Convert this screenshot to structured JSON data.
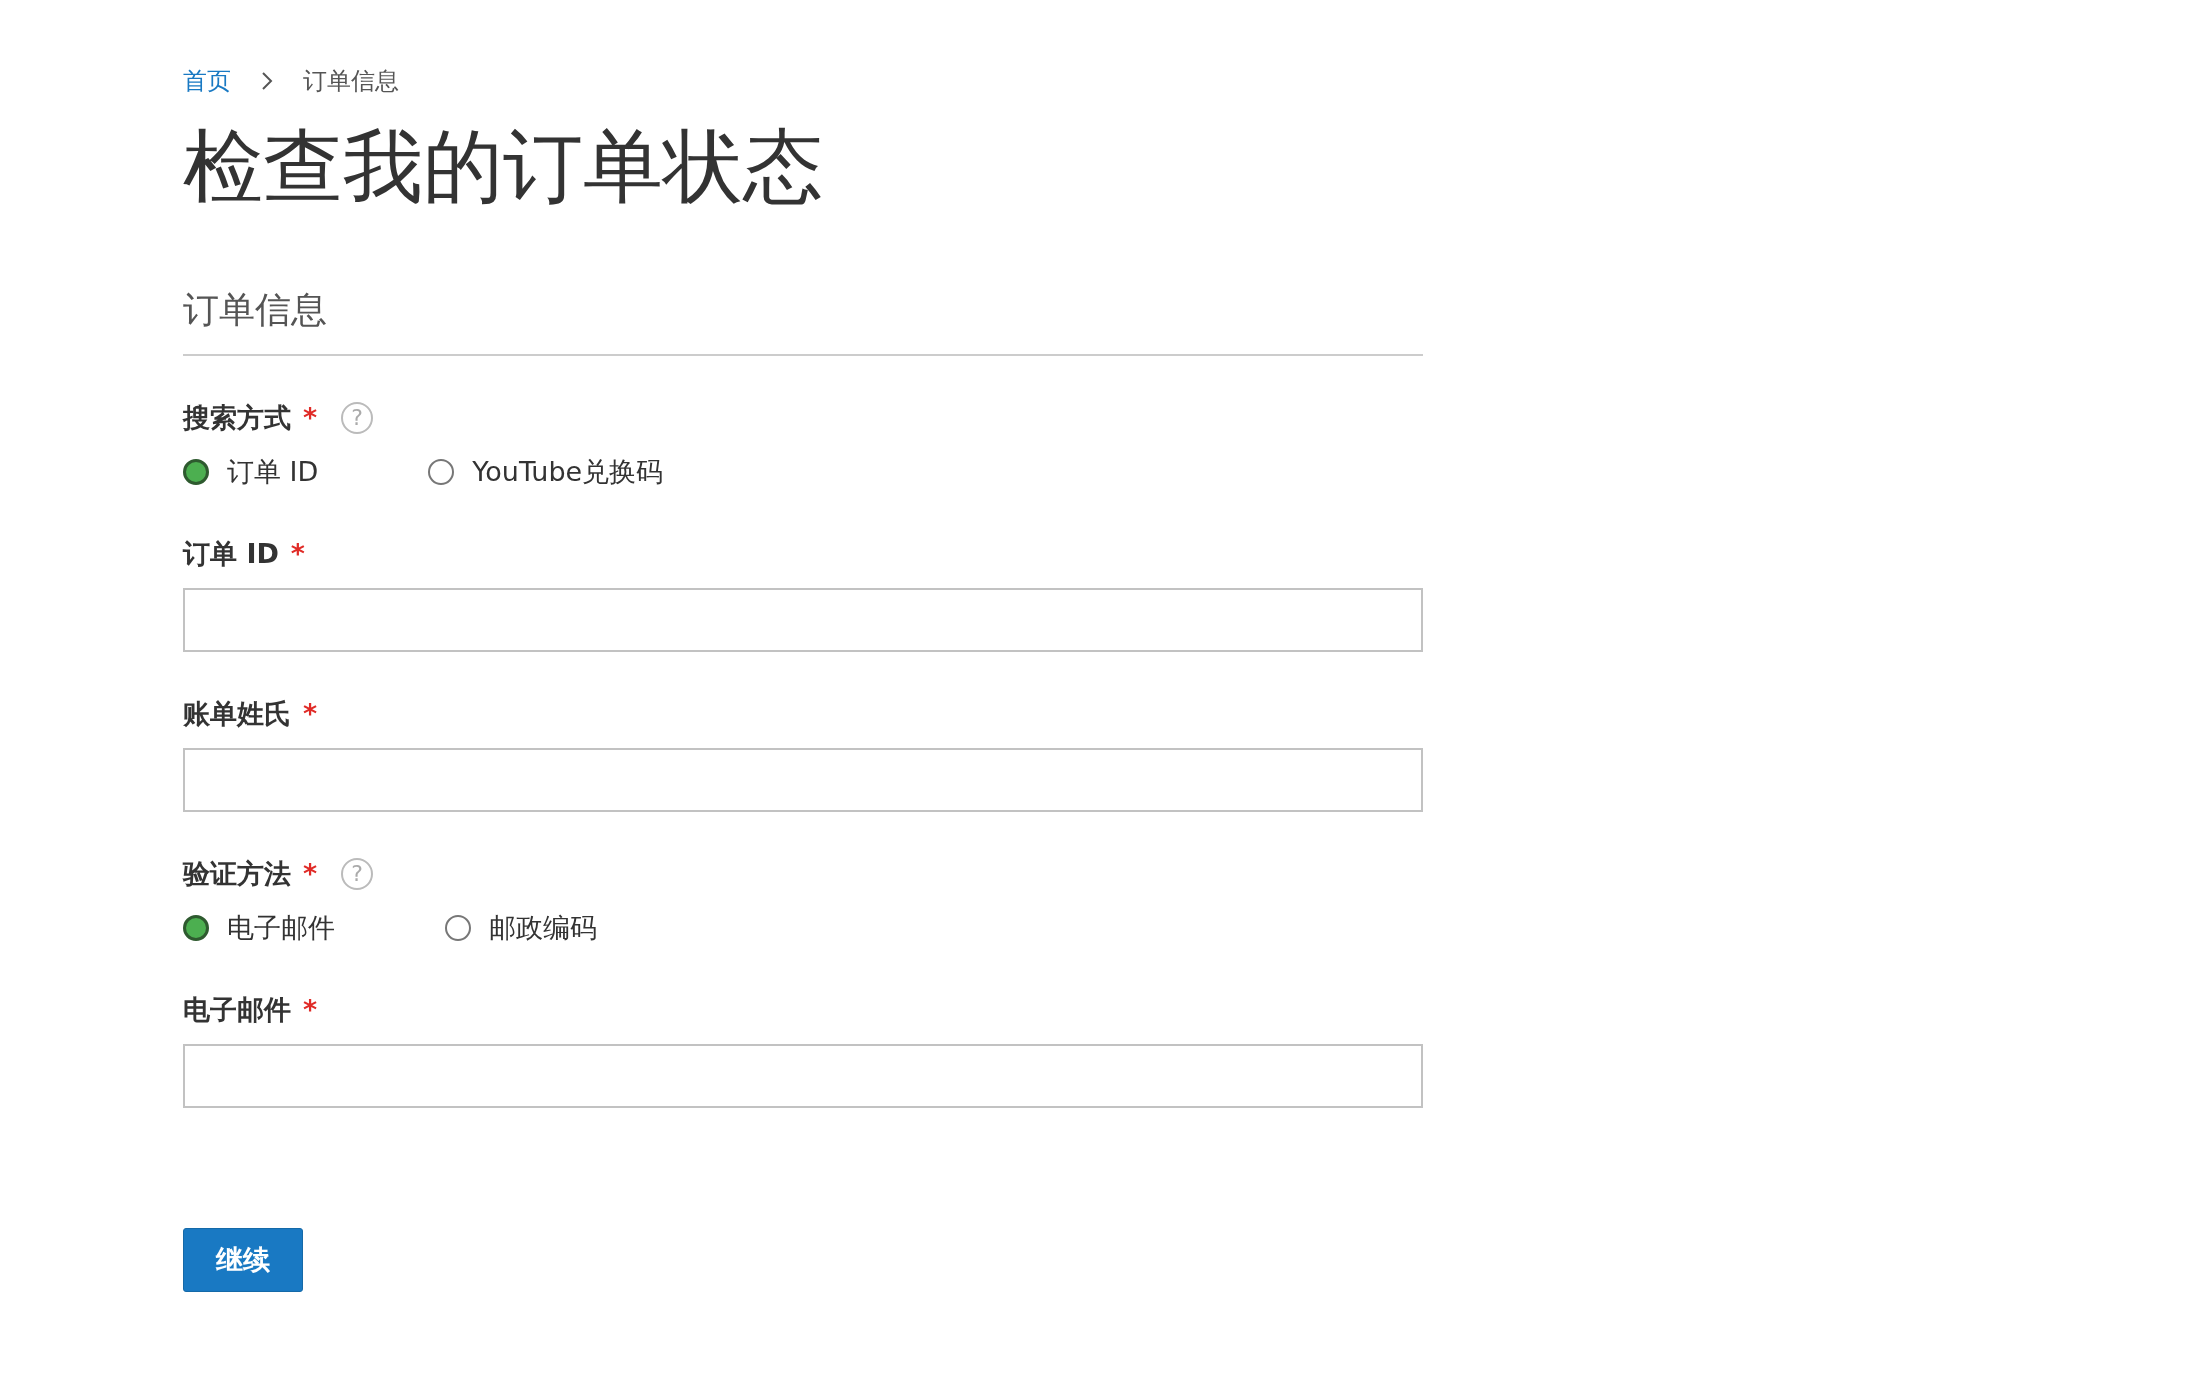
{
  "breadcrumb": [
    {
      "label": "首页",
      "kind": "link"
    },
    {
      "label": "订单信息",
      "kind": "current"
    }
  ],
  "title": "检查我的订单状态",
  "section_title": "订单信息",
  "fields": [
    {
      "kind": "radio_group",
      "label": "搜索方式",
      "required_mark": "*",
      "help": "?",
      "options": [
        {
          "label": "订单 ID",
          "selected": true
        },
        {
          "label": "YouTube兑换码",
          "selected": false
        }
      ]
    },
    {
      "kind": "text_input",
      "label": "订单 ID",
      "required_mark": "*"
    },
    {
      "kind": "text_input",
      "label": "账单姓氏",
      "required_mark": "*"
    },
    {
      "kind": "radio_group",
      "label": "验证方法",
      "required_mark": "*",
      "help": "?",
      "options": [
        {
          "label": "电子邮件",
          "selected": true
        },
        {
          "label": "邮政编码",
          "selected": false
        }
      ]
    },
    {
      "kind": "text_input",
      "label": "电子邮件",
      "required_mark": "*"
    }
  ],
  "submit_button": "继续"
}
